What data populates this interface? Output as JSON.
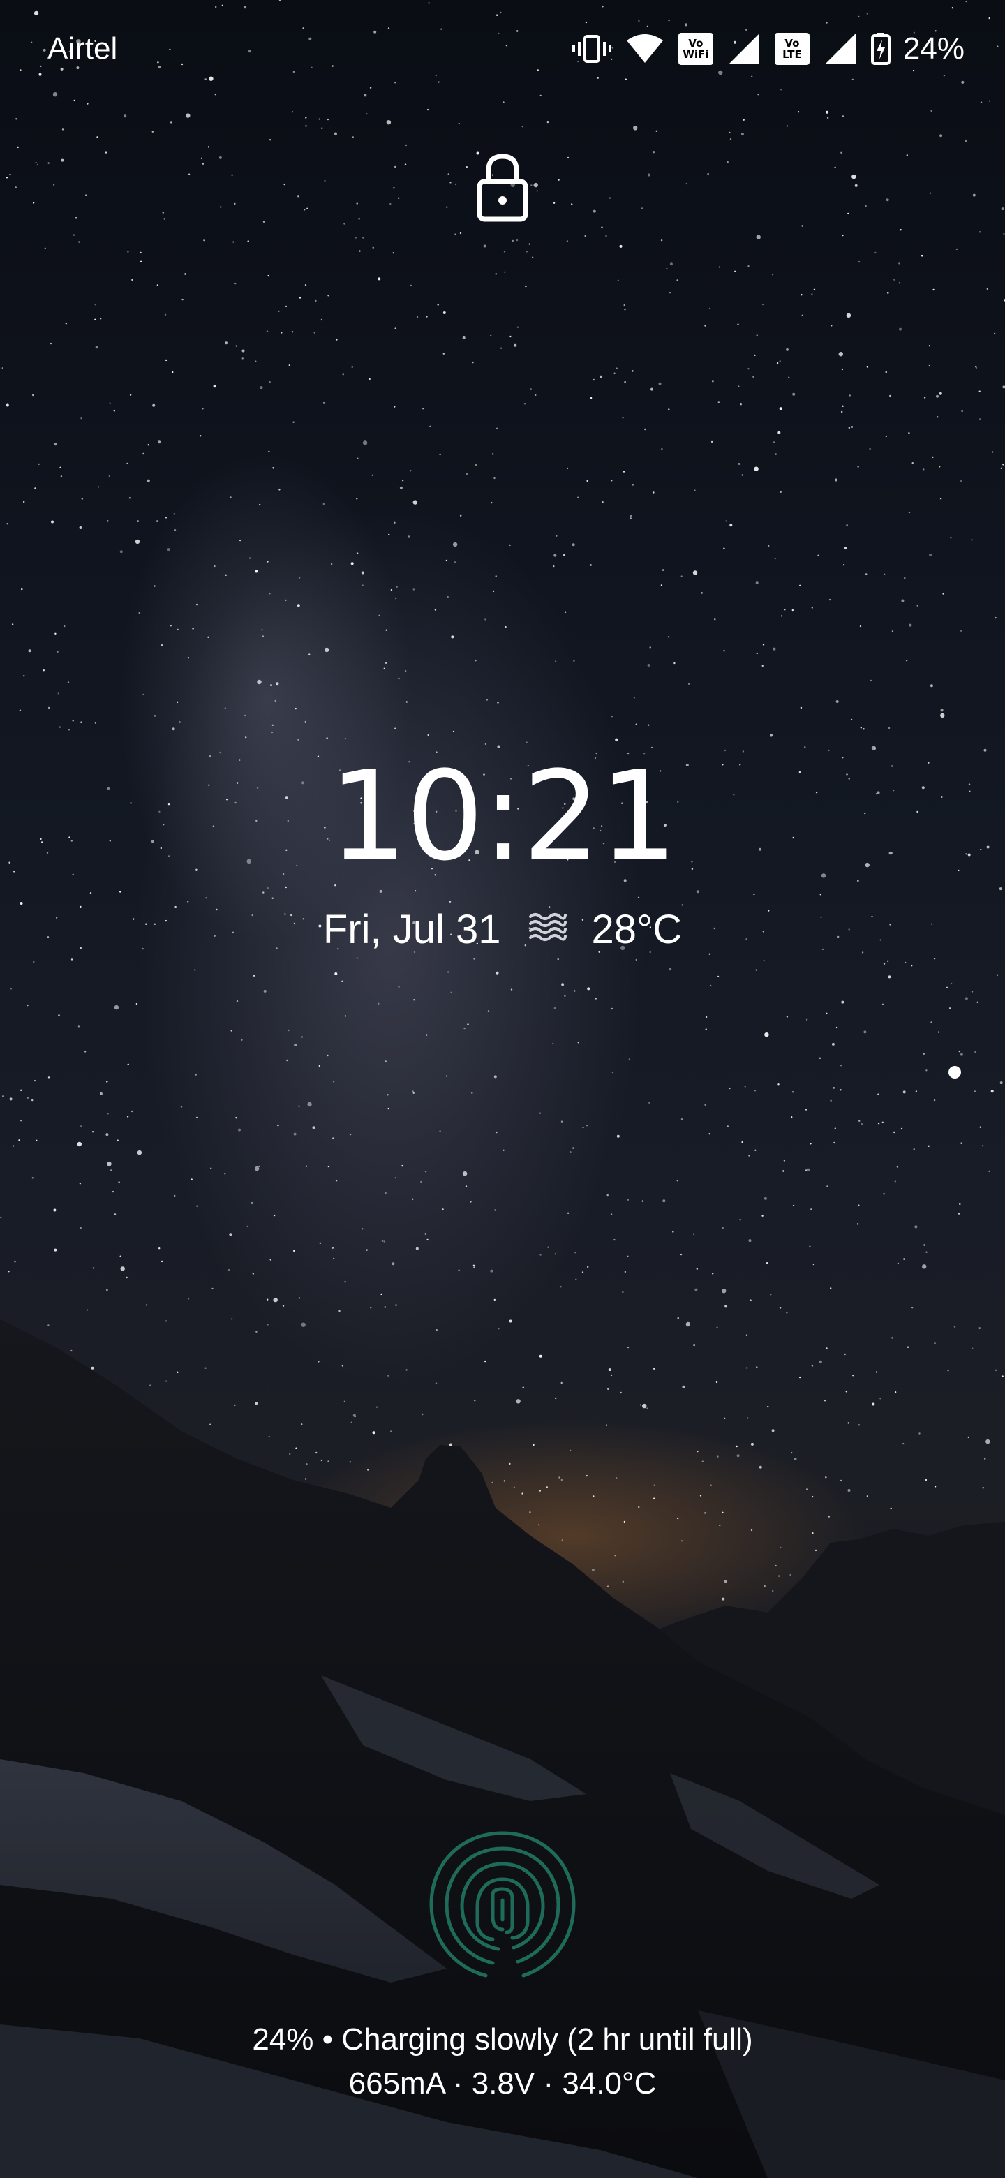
{
  "status_bar": {
    "carrier": "Airtel",
    "battery_percent": "24%",
    "wifi_badge_top": "Vo",
    "wifi_badge_bottom": "WiFi",
    "lte_badge_top": "Vo",
    "lte_badge_bottom": "LTE",
    "icons": [
      "vibrate-icon",
      "wifi-icon",
      "vowifi-icon",
      "signal-icon",
      "volte-icon",
      "signal-icon",
      "battery-charging-icon"
    ]
  },
  "lockscreen": {
    "lock_icon": "lock-icon",
    "time": "10:21",
    "date": "Fri, Jul 31",
    "weather_icon": "haze-icon",
    "temperature": "28°C",
    "fingerprint_icon": "fingerprint-icon"
  },
  "charging": {
    "status": "24% • Charging slowly (2 hr until full)",
    "detail": "665mA · 3.8V · 34.0°C"
  },
  "colors": {
    "fingerprint": "#1f6b5a",
    "text": "#ffffff"
  }
}
